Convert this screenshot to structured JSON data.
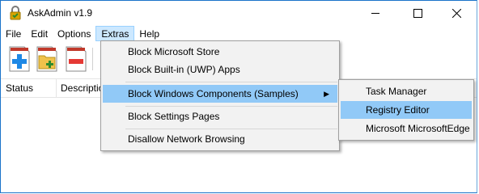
{
  "window": {
    "title": "AskAdmin v1.9"
  },
  "menubar": [
    "File",
    "Edit",
    "Options",
    "Extras",
    "Help"
  ],
  "list": {
    "columns": [
      "Status",
      "Description"
    ]
  },
  "extras_menu": {
    "items": [
      "Block Microsoft Store",
      "Block Built-in (UWP) Apps",
      "Block Windows Components (Samples)",
      "Block Settings Pages",
      "Disallow Network Browsing"
    ]
  },
  "submenu": {
    "items": [
      "Task Manager",
      "Registry Editor",
      "Microsoft MicrosoftEdge"
    ]
  },
  "colors": {
    "highlight": "#91c9f7",
    "active_menu": "#cce8ff"
  }
}
